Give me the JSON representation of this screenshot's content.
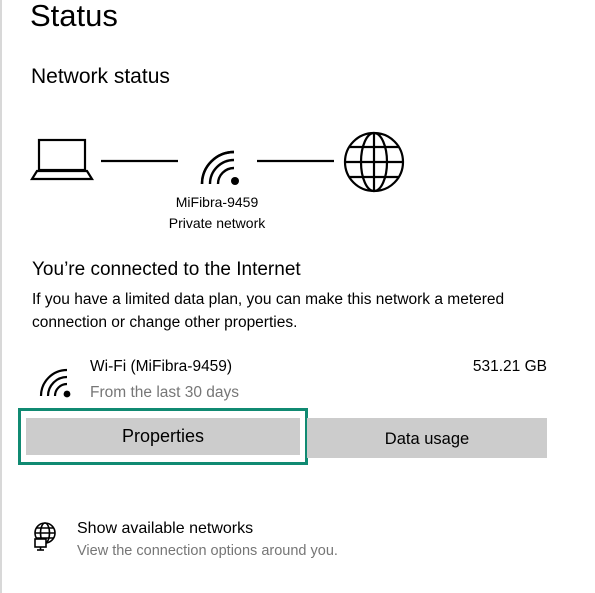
{
  "page": {
    "title": "Status"
  },
  "network_status": {
    "heading": "Network status",
    "network_name": "MiFibra-9459",
    "network_type": "Private network"
  },
  "connection": {
    "heading": "You’re connected to the Internet",
    "description": "If you have a limited data plan, you can make this network a metered connection or change other properties."
  },
  "adapter": {
    "name": "Wi-Fi (MiFibra-9459)",
    "period": "From the last 30 days",
    "usage": "531.21 GB",
    "icon": "wifi-icon"
  },
  "buttons": {
    "properties_label": "Properties",
    "data_usage_label": "Data usage"
  },
  "show_networks": {
    "label": "Show available networks",
    "description": "View the connection options around you.",
    "icon": "globe-monitor-icon"
  },
  "colors": {
    "focus_border": "#108a72",
    "button_bg": "#cccccc",
    "secondary_text": "#767676"
  }
}
